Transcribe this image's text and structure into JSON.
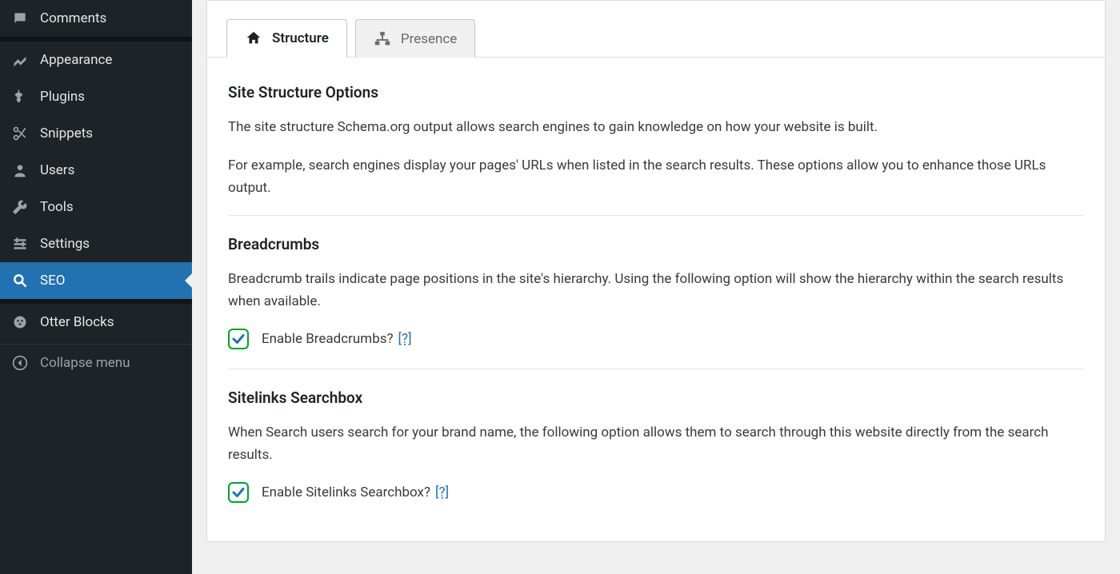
{
  "sidebar": {
    "items": [
      {
        "key": "comments",
        "label": "Comments"
      },
      {
        "key": "appearance",
        "label": "Appearance"
      },
      {
        "key": "plugins",
        "label": "Plugins"
      },
      {
        "key": "snippets",
        "label": "Snippets"
      },
      {
        "key": "users",
        "label": "Users"
      },
      {
        "key": "tools",
        "label": "Tools"
      },
      {
        "key": "settings",
        "label": "Settings"
      },
      {
        "key": "seo",
        "label": "SEO"
      },
      {
        "key": "otter",
        "label": "Otter Blocks"
      }
    ],
    "collapse_label": "Collapse menu"
  },
  "tabs": {
    "structure": {
      "label": "Structure"
    },
    "presence": {
      "label": "Presence"
    }
  },
  "sections": {
    "site_structure": {
      "heading": "Site Structure Options",
      "p1": "The site structure Schema.org output allows search engines to gain knowledge on how your website is built.",
      "p2": "For example, search engines display your pages' URLs when listed in the search results. These options allow you to enhance those URLs output."
    },
    "breadcrumbs": {
      "heading": "Breadcrumbs",
      "desc": "Breadcrumb trails indicate page positions in the site's hierarchy. Using the following option will show the hierarchy within the search results when available.",
      "option_label": "Enable Breadcrumbs?",
      "help": "[?]",
      "checked": true
    },
    "sitelinks": {
      "heading": "Sitelinks Searchbox",
      "desc": "When Search users search for your brand name, the following option allows them to search through this website directly from the search results.",
      "option_label": "Enable Sitelinks Searchbox?",
      "help": "[?]",
      "checked": true
    }
  }
}
